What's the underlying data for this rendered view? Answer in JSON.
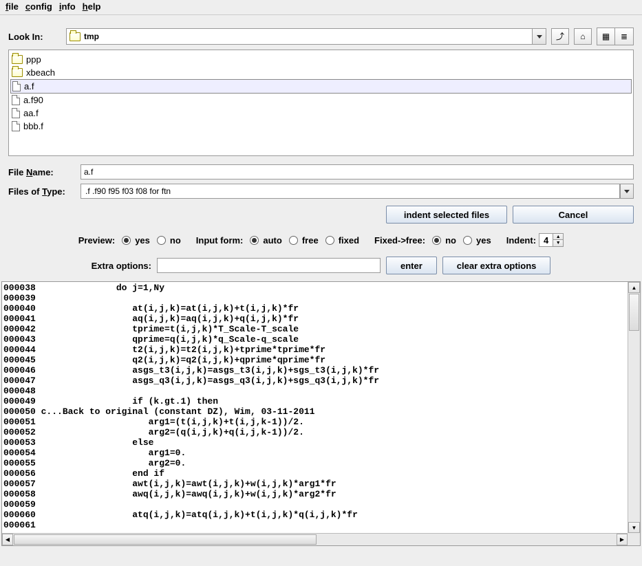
{
  "menu": {
    "file": "file",
    "config": "config",
    "info": "info",
    "help": "help"
  },
  "lookin": {
    "label": "Look In:",
    "value": "tmp"
  },
  "files": [
    {
      "name": "ppp",
      "type": "folder",
      "selected": false
    },
    {
      "name": "xbeach",
      "type": "folder",
      "selected": false
    },
    {
      "name": "a.f",
      "type": "file",
      "selected": true
    },
    {
      "name": "a.f90",
      "type": "file",
      "selected": false
    },
    {
      "name": "aa.f",
      "type": "file",
      "selected": false
    },
    {
      "name": "bbb.f",
      "type": "file",
      "selected": false
    }
  ],
  "filename": {
    "label": "File Name:",
    "value": "a.f"
  },
  "filetype": {
    "label": "Files of Type:",
    "value": ".f .f90 f95 f03 f08 for ftn"
  },
  "buttons": {
    "indent": "indent selected files",
    "cancel": "Cancel"
  },
  "preview": {
    "label": "Preview:",
    "yes": "yes",
    "no": "no",
    "selected": "yes"
  },
  "inputform": {
    "label": "Input form:",
    "auto": "auto",
    "free": "free",
    "fixed": "fixed",
    "selected": "auto"
  },
  "fixed2free": {
    "label": "Fixed->free:",
    "no": "no",
    "yes": "yes",
    "selected": "no"
  },
  "indent": {
    "label": "Indent:",
    "value": "4"
  },
  "extra": {
    "label": "Extra options:",
    "value": "",
    "enter": "enter",
    "clear": "clear extra options"
  },
  "code": [
    "000038               do j=1,Ny",
    "000039",
    "000040                  at(i,j,k)=at(i,j,k)+t(i,j,k)*fr",
    "000041                  aq(i,j,k)=aq(i,j,k)+q(i,j,k)*fr",
    "000042                  tprime=t(i,j,k)*T_Scale-T_scale",
    "000043                  qprime=q(i,j,k)*q_Scale-q_scale",
    "000044                  t2(i,j,k)=t2(i,j,k)+tprime*tprime*fr",
    "000045                  q2(i,j,k)=q2(i,j,k)+qprime*qprime*fr",
    "000046                  asgs_t3(i,j,k)=asgs_t3(i,j,k)+sgs_t3(i,j,k)*fr",
    "000047                  asgs_q3(i,j,k)=asgs_q3(i,j,k)+sgs_q3(i,j,k)*fr",
    "000048",
    "000049                  if (k.gt.1) then",
    "000050 c...Back to original (constant DZ), Wim, 03-11-2011",
    "000051                     arg1=(t(i,j,k)+t(i,j,k-1))/2.",
    "000052                     arg2=(q(i,j,k)+q(i,j,k-1))/2.",
    "000053                  else",
    "000054                     arg1=0.",
    "000055                     arg2=0.",
    "000056                  end if",
    "000057                  awt(i,j,k)=awt(i,j,k)+w(i,j,k)*arg1*fr",
    "000058                  awq(i,j,k)=awq(i,j,k)+w(i,j,k)*arg2*fr",
    "000059",
    "000060                  atq(i,j,k)=atq(i,j,k)+t(i,j,k)*q(i,j,k)*fr",
    "000061"
  ]
}
